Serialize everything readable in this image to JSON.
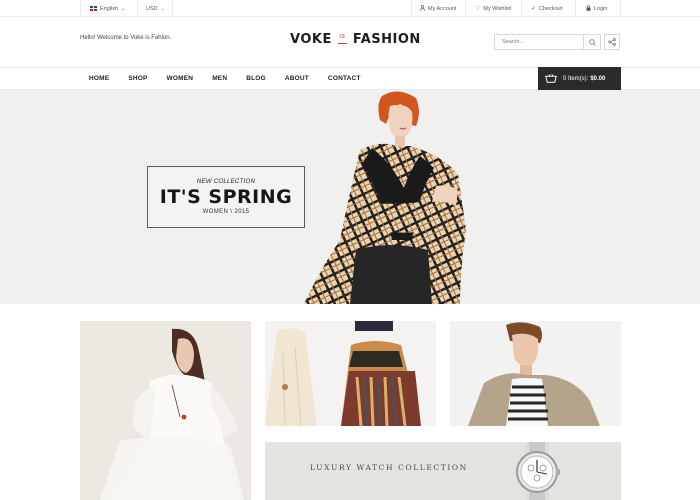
{
  "topbar": {
    "language": "English",
    "currency": "USD",
    "my_account": "My Account",
    "my_wishlist": "My Wishlist",
    "checkout": "Checkout",
    "login": "Login"
  },
  "header": {
    "welcome": "Hello! Welcome to Voke is Fahion.",
    "logo_left": "VOKE",
    "logo_mid": "IS",
    "logo_right": "FASHION",
    "search_placeholder": "Search..."
  },
  "nav": {
    "items": [
      "HOME",
      "SHOP",
      "WOMEN",
      "MEN",
      "BLOG",
      "ABOUT",
      "CONTACT"
    ]
  },
  "cart": {
    "items_label": "0 Item(s):",
    "total": "$0.00"
  },
  "hero": {
    "subtitle": "NEW COLLECTION",
    "title": "IT'S SPRING",
    "caption": "WOMEN \\ 2015"
  },
  "tiles": {
    "watch_label": "LUXURY WATCH COLLECTION"
  },
  "colors": {
    "accent": "#d03b2a",
    "cart_bg": "#2b2b2b",
    "hero_bg": "#f0f0ef"
  }
}
